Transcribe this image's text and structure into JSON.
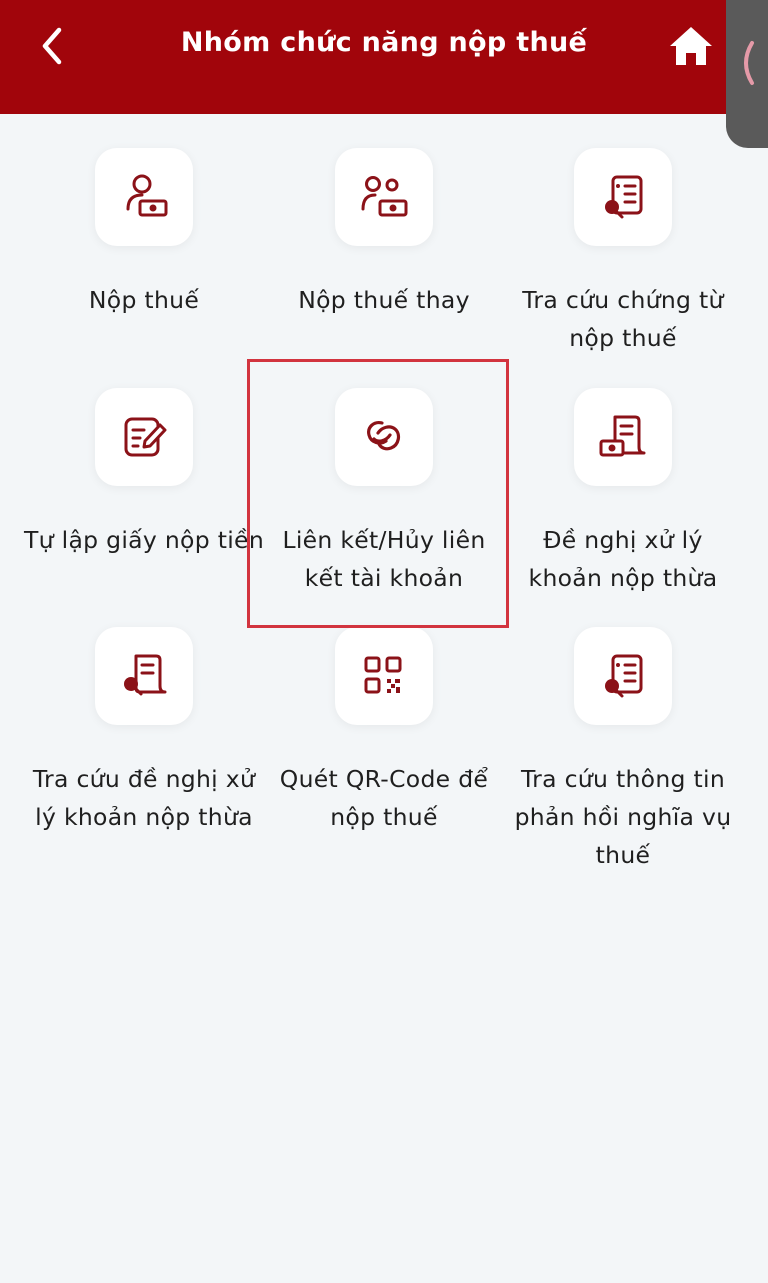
{
  "header": {
    "title": "Nhóm chức năng nộp thuế",
    "back_icon": "chevron-left-icon",
    "home_icon": "home-icon",
    "background": "#a1050b"
  },
  "accent_color": "#8b1218",
  "highlight_color": "#d2343f",
  "items": [
    {
      "label": "Nộp thuế",
      "icon": "person-money-icon"
    },
    {
      "label": "Nộp thuế thay",
      "icon": "people-money-icon"
    },
    {
      "label": "Tra cứu chứng từ nộp thuế",
      "icon": "document-search-icon"
    },
    {
      "label": "Tự lập giấy nộp tiền",
      "icon": "edit-form-icon"
    },
    {
      "label": "Liên kết/Hủy liên kết tài khoản",
      "icon": "link-icon"
    },
    {
      "label": "Đề nghị xử lý khoản nộp thừa",
      "icon": "receipt-money-icon"
    },
    {
      "label": "Tra cứu đề nghị xử lý khoản nộp thừa",
      "icon": "receipt-search-icon"
    },
    {
      "label": "Quét QR-Code để nộp thuế",
      "icon": "qr-code-icon"
    },
    {
      "label": "Tra cứu thông tin phản hồi nghĩa vụ thuế",
      "icon": "document-search-icon"
    }
  ]
}
